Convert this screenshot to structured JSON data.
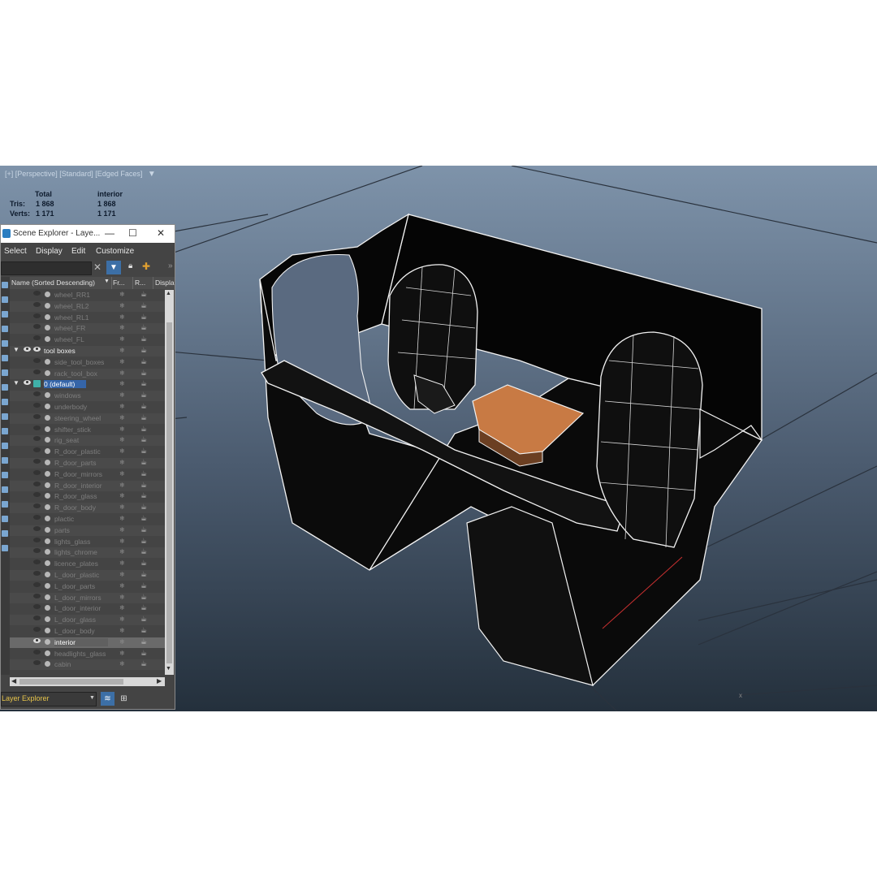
{
  "viewport": {
    "label": "[+] [Perspective] [Standard] [Edged Faces]",
    "stats": {
      "col_total": "Total",
      "col_selection": "interior",
      "tris_label": "Tris:",
      "tris_total": "1 868",
      "tris_selection": "1 868",
      "verts_label": "Verts:",
      "verts_total": "1 171",
      "verts_selection": "1 171"
    },
    "selection_color": "#c87a44"
  },
  "scene_explorer": {
    "title": "Scene Explorer - Laye...",
    "window_buttons": {
      "minimize": "—",
      "maximize": "☐",
      "close": "✕"
    },
    "menu": [
      "Select",
      "Display",
      "Edit",
      "Customize"
    ],
    "columns": {
      "name": "Name (Sorted Descending)",
      "freeze": "Fr...",
      "render": "R...",
      "display": "Displa"
    },
    "rows": [
      {
        "label": "wheel_RR1",
        "kind": "object"
      },
      {
        "label": "wheel_RL2",
        "kind": "object"
      },
      {
        "label": "wheel_RL1",
        "kind": "object"
      },
      {
        "label": "wheel_FR",
        "kind": "object"
      },
      {
        "label": "wheel_FL",
        "kind": "object"
      },
      {
        "label": "tool boxes",
        "kind": "layer"
      },
      {
        "label": "side_tool_boxes",
        "kind": "object"
      },
      {
        "label": "rack_tool_box",
        "kind": "object"
      },
      {
        "label": "0 (default)",
        "kind": "default-layer"
      },
      {
        "label": "windows",
        "kind": "object"
      },
      {
        "label": "underbody",
        "kind": "object"
      },
      {
        "label": "steering_wheel",
        "kind": "object"
      },
      {
        "label": "shifter_stick",
        "kind": "object"
      },
      {
        "label": "rig_seat",
        "kind": "object"
      },
      {
        "label": "R_door_plastic",
        "kind": "object"
      },
      {
        "label": "R_door_parts",
        "kind": "object"
      },
      {
        "label": "R_door_mirrors",
        "kind": "object"
      },
      {
        "label": "R_door_interior",
        "kind": "object"
      },
      {
        "label": "R_door_glass",
        "kind": "object"
      },
      {
        "label": "R_door_body",
        "kind": "object"
      },
      {
        "label": "plactic",
        "kind": "object"
      },
      {
        "label": "parts",
        "kind": "object"
      },
      {
        "label": "lights_glass",
        "kind": "object"
      },
      {
        "label": "lights_chrome",
        "kind": "object"
      },
      {
        "label": "licence_plates",
        "kind": "object"
      },
      {
        "label": "L_door_plastic",
        "kind": "object"
      },
      {
        "label": "L_door_parts",
        "kind": "object"
      },
      {
        "label": "L_door_mirrors",
        "kind": "object"
      },
      {
        "label": "L_door_interior",
        "kind": "object"
      },
      {
        "label": "L_door_glass",
        "kind": "object"
      },
      {
        "label": "L_door_body",
        "kind": "object"
      },
      {
        "label": "interior",
        "kind": "selected"
      },
      {
        "label": "headlights_glass",
        "kind": "object"
      },
      {
        "label": "cabin",
        "kind": "object"
      }
    ],
    "bottom_combo": "Layer Explorer",
    "colors": {
      "highlight": "#3565a8",
      "panel": "#444444"
    }
  }
}
